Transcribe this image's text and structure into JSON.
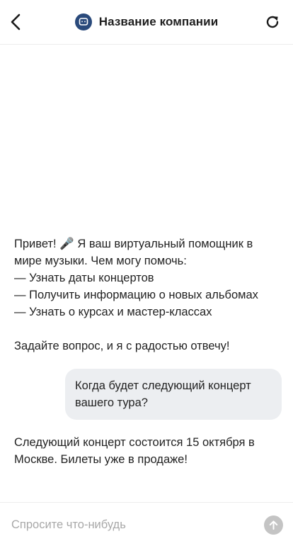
{
  "header": {
    "title": "Название компании"
  },
  "messages": {
    "bot_greeting": [
      "Привет! 🎤 Я ваш виртуальный помощник в мире музыки. Чем могу помочь:",
      "— Узнать даты концертов",
      "— Получить информацию о новых альбомах",
      "— Узнать о курсах и мастер-классах",
      "Задайте вопрос, и я с радостью отвечу!"
    ],
    "user_question": "Когда будет следующий концерт вашего тура?",
    "bot_answer": "Следующий концерт состоится 15 октября в Москве. Билеты уже в продаже!"
  },
  "input": {
    "placeholder": "Спросите что-нибудь",
    "value": ""
  },
  "colors": {
    "logo_bg": "#2a4a7b",
    "user_bubble_bg": "#eceef1",
    "send_button_bg": "#c4c4c4"
  },
  "icons": {
    "back": "chevron-left-icon",
    "logo": "chat-bot-icon",
    "refresh": "refresh-icon",
    "send": "arrow-up-icon"
  }
}
